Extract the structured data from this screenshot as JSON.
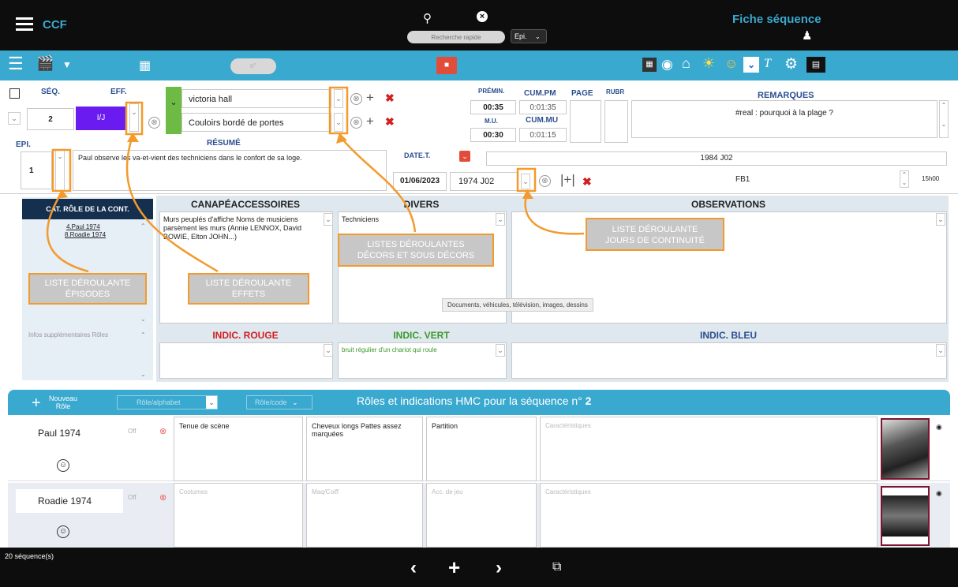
{
  "top": {
    "app": "CCF",
    "search_placeholder": "Recherche rapide",
    "epi_select": "Epi.",
    "title": "Fiche séquence"
  },
  "toolbar": {
    "pill": "n°"
  },
  "seq": {
    "seq_label": "SÉQ.",
    "eff_label": "EFF.",
    "seq_value": "2",
    "eff_value": "I/J",
    "epi_label": "EPI.",
    "epi_value": "1",
    "decor1": "victoria hall",
    "decor2": "Couloirs bordé de portes",
    "resume_label": "RÉSUMÉ",
    "resume_text": "Paul observe les va-et-vient des techniciens dans le confort de sa loge.",
    "premin_label": "PRÉMIN.",
    "premin_value": "00:35",
    "cumpm_label": "CUM.PM",
    "cumpm_value": "0:01:35",
    "mu_label": "M.U.",
    "mu_value": "00:30",
    "cummu_label": "CUM.MU",
    "cummu_value": "0:01:15",
    "page_label": "PAGE",
    "rubr_label": "RUBR",
    "remarques_label": "REMARQUES",
    "remarques_value": "#real : pourquoi à la plage ?",
    "datet_label": "DATE.T.",
    "datet_value": "01/06/2023",
    "jour_value": "1974 J02",
    "j02_full": "1984 J02",
    "fb1": "FB1",
    "time": "15h00"
  },
  "panels": {
    "roles_header": "CAT. RÔLE DE LA CONT.",
    "roles": [
      "4.Paul 1974",
      "8.Roadie 1974"
    ],
    "infos_label": "Infos supplémentaires Rôles",
    "canape_header": "CANAPÉACCESSOIRES",
    "canape_text": "Murs peuplés d'affiche Noms de musiciens parsèment les murs (Annie LENNOX, David BOWIE, Elton JOHN...)",
    "divers_header": "DIVERS",
    "divers_text": "Techniciens",
    "observations_header": "OBSERVATIONS",
    "tooltip": "Documents, véhicules, télévision, images, dessins",
    "indic_rouge": "INDIC. ROUGE",
    "indic_vert": "INDIC. VERT",
    "indic_vert_text": "bruit régulier d'un chariot qui roule",
    "indic_bleu": "INDIC. BLEU"
  },
  "annotations": {
    "a1": "LISTE DÉROULANTE ÉPISODES",
    "a2": "LISTE DÉROULANTE EFFETS",
    "a3": "LISTES DÉROULANTES DÉCORS ET SOUS DÉCORS",
    "a4": "LISTE DÉROULANTE JOURS DE CONTINUITÉ"
  },
  "hmc": {
    "nouveau": "Nouveau Rôle",
    "alpha": "Rôle/alphabet",
    "code": "Rôle/code",
    "title_prefix": "Rôles et indications HMC pour la séquence n°",
    "title_num": "2",
    "rows": [
      {
        "name": "Paul 1974",
        "off": "Off",
        "costume": "Tenue de scène",
        "maq": "Cheveux longs Pattes assez marquées",
        "acc": "Partition",
        "carac": "Caractéristiques"
      },
      {
        "name": "Roadie 1974",
        "off": "Off",
        "costume": "Costumes",
        "maq": "Maq/Coiff",
        "acc": "Acc. de jeu",
        "carac": "Caractéristiques"
      }
    ]
  },
  "footer": {
    "count": "20 séquence(s)"
  },
  "colors": {
    "accent": "#3aa9cf",
    "orange": "#f39a2c",
    "eff_purple": "#6a1bf0",
    "green": "#6dbb45"
  }
}
